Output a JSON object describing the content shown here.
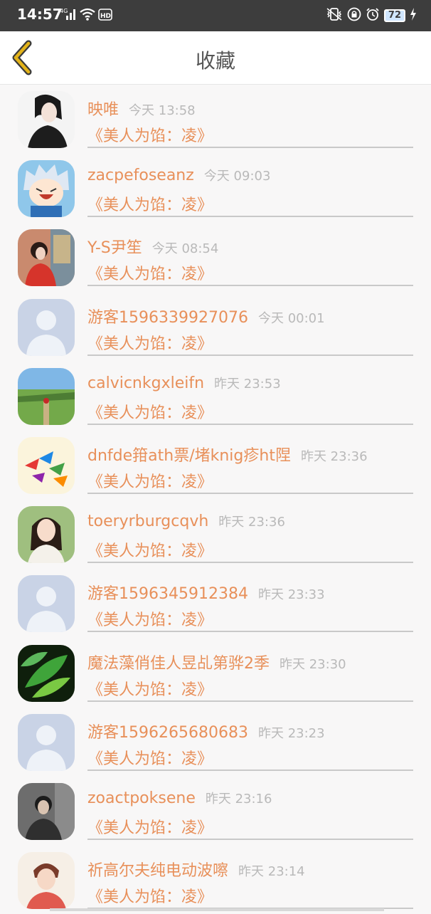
{
  "status_bar": {
    "time": "14:57",
    "network": "4G",
    "hd_label": "HD",
    "battery": "72"
  },
  "header": {
    "title": "收藏",
    "back_icon": "chevron-left-icon",
    "accent_color": "#e3b31a"
  },
  "items": [
    {
      "name": "映唯",
      "time": "今天 13:58",
      "title": "《美人为馅：凌》",
      "avatar": "portrait-dark"
    },
    {
      "name": "zacpefoseanz",
      "time": "今天 09:03",
      "title": "《美人为馅：凌》",
      "avatar": "cartoon-blue"
    },
    {
      "name": "Y-S尹笙",
      "time": "今天 08:54",
      "title": "《美人为馅：凌》",
      "avatar": "photo-red"
    },
    {
      "name": "游客1596339927076",
      "time": "今天 00:01",
      "title": "《美人为馅：凌》",
      "avatar": "default-user"
    },
    {
      "name": "calvicnkgxleifn",
      "time": "昨天 23:53",
      "title": "《美人为馅：凌》",
      "avatar": "photo-landscape"
    },
    {
      "name": "dnfde箝ath票/堵knig疹ht陧",
      "time": "昨天 23:36",
      "title": "《美人为馅：凌》",
      "avatar": "paper-cranes"
    },
    {
      "name": "toeryrburgcqvh",
      "time": "昨天 23:36",
      "title": "《美人为馅：凌》",
      "avatar": "portrait-girl"
    },
    {
      "name": "游客1596345912384",
      "time": "昨天 23:33",
      "title": "《美人为馅：凌》",
      "avatar": "default-user"
    },
    {
      "name": "魔法藻俏佳人昱乩第骅2季",
      "time": "昨天 23:30",
      "title": "《美人为馅：凌》",
      "avatar": "green-leaves"
    },
    {
      "name": "游客1596265680683",
      "time": "昨天 23:23",
      "title": "《美人为馅：凌》",
      "avatar": "default-user"
    },
    {
      "name": "zoactpoksene",
      "time": "昨天 23:16",
      "title": "《美人为馅：凌》",
      "avatar": "portrait-studio"
    },
    {
      "name": "祈高尔夫纯电动波嚓",
      "time": "昨天 23:14",
      "title": "《美人为馅：凌》",
      "avatar": "portrait-boy"
    }
  ],
  "colors": {
    "accent_text": "#e8905a",
    "muted_text": "#b9b9b9",
    "status_bar_bg": "#3d3d3d"
  }
}
